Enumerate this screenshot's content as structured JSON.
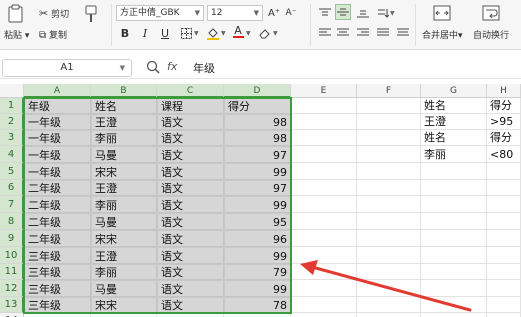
{
  "ribbon": {
    "clipboard": {
      "cut": "剪切",
      "paste": "粘贴",
      "copy": "复制",
      "format_painter": "格式刷"
    },
    "font_name": "方正中倩_GBK",
    "font_size": "12",
    "bold": "B",
    "italic": "I",
    "underline": "U",
    "font_color_letter": "A",
    "merge_center": "合并居中",
    "wrap_text": "自动换行"
  },
  "formula_bar": {
    "cell_ref": "A1",
    "fx": "fx",
    "content": "年级"
  },
  "sheet": {
    "columns": [
      "A",
      "B",
      "C",
      "D",
      "E",
      "F",
      "G",
      "H"
    ],
    "rows": [
      "1",
      "2",
      "3",
      "4",
      "5",
      "6",
      "7",
      "8",
      "9",
      "10",
      "11",
      "12",
      "13",
      "14"
    ],
    "table": [
      [
        "年级",
        "姓名",
        "课程",
        "得分"
      ],
      [
        "一年级",
        "王澄",
        "语文",
        "98"
      ],
      [
        "一年级",
        "李丽",
        "语文",
        "98"
      ],
      [
        "一年级",
        "马曼",
        "语文",
        "97"
      ],
      [
        "一年级",
        "宋宋",
        "语文",
        "99"
      ],
      [
        "二年级",
        "王澄",
        "语文",
        "97"
      ],
      [
        "二年级",
        "李丽",
        "语文",
        "99"
      ],
      [
        "二年级",
        "马曼",
        "语文",
        "95"
      ],
      [
        "二年级",
        "宋宋",
        "语文",
        "96"
      ],
      [
        "三年级",
        "王澄",
        "语文",
        "99"
      ],
      [
        "三年级",
        "李丽",
        "语文",
        "79"
      ],
      [
        "三年级",
        "马曼",
        "语文",
        "99"
      ],
      [
        "三年级",
        "宋宋",
        "语文",
        "78"
      ]
    ],
    "criteria": [
      [
        "姓名",
        "得分"
      ],
      [
        "王澄",
        ">95"
      ],
      [
        "姓名",
        "得分"
      ],
      [
        "李丽",
        "<80"
      ]
    ]
  },
  "colors": {
    "selection": "#3d9b3d",
    "selected_fill": "#d6d6d6",
    "arrow": "#e23b32"
  }
}
